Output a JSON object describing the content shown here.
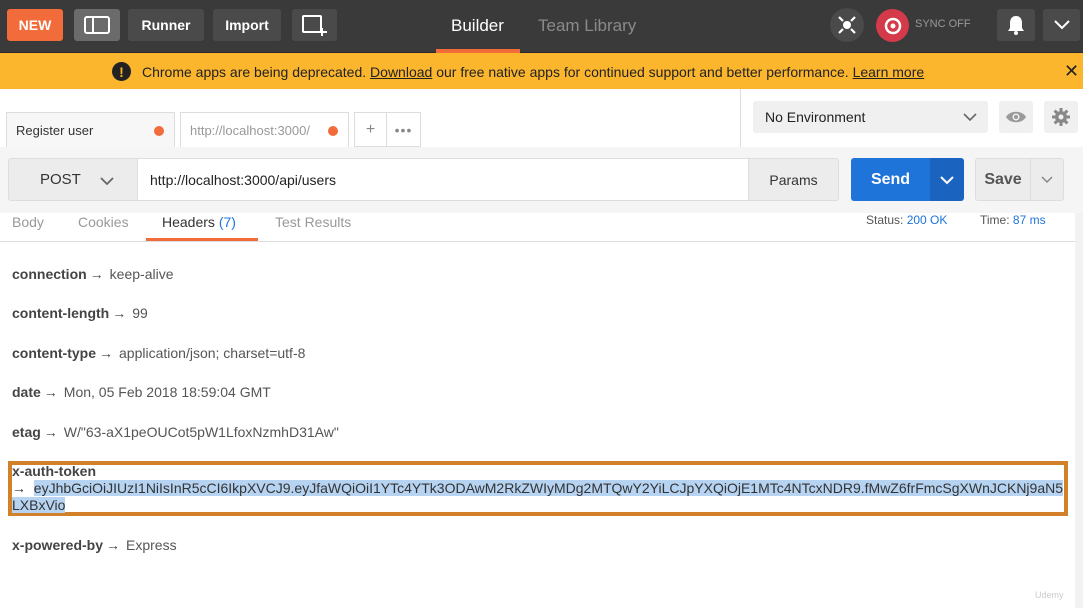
{
  "topbar": {
    "new_label": "NEW",
    "runner_label": "Runner",
    "import_label": "Import",
    "tabs": [
      {
        "label": "Builder"
      },
      {
        "label": "Team Library"
      }
    ],
    "sync_label": "SYNC OFF"
  },
  "banner": {
    "text_before": "Chrome apps are being deprecated. ",
    "link1": "Download",
    "text_middle": " our free native apps for continued support and better performance. ",
    "link2": "Learn more",
    "close": "✕"
  },
  "request_tabs": [
    {
      "label": "Register user"
    },
    {
      "label": "http://localhost:3000/"
    }
  ],
  "environment": {
    "selected": "No Environment"
  },
  "request": {
    "method": "POST",
    "url": "http://localhost:3000/api/users",
    "params_label": "Params",
    "send_label": "Send",
    "save_label": "Save"
  },
  "response": {
    "tabs": {
      "body": "Body",
      "cookies": "Cookies",
      "headers": "Headers",
      "headers_count": "(7)",
      "tests": "Test Results"
    },
    "status_label": "Status:",
    "status_value": "200 OK",
    "time_label": "Time:",
    "time_value": "87 ms",
    "headers": [
      {
        "key": "connection",
        "value": "keep-alive"
      },
      {
        "key": "content-length",
        "value": "99"
      },
      {
        "key": "content-type",
        "value": "application/json; charset=utf-8"
      },
      {
        "key": "date",
        "value": "Mon, 05 Feb 2018 18:59:04 GMT"
      },
      {
        "key": "etag",
        "value": "W/\"63-aX1peOUCot5pW1LfoxNzmhD31Aw\""
      },
      {
        "key": "x-auth-token",
        "value": "eyJhbGciOiJIUzI1NiIsInR5cCI6IkpXVCJ9.eyJfaWQiOiI1YTc4YTk3ODAwM2RkZWIyMDg2MTQwY2YiLCJpYXQiOjE1MTc4NTcxNDR9.fMwZ6frFmcSgXWnJCKNj9aN5LXBxVio"
      },
      {
        "key": "x-powered-by",
        "value": "Express"
      }
    ]
  },
  "watermark": "Udemy",
  "colors": {
    "accent": "#f26b3a",
    "send": "#1f74d9",
    "banner": "#fcb62e",
    "highlight_box": "#d3802a"
  }
}
